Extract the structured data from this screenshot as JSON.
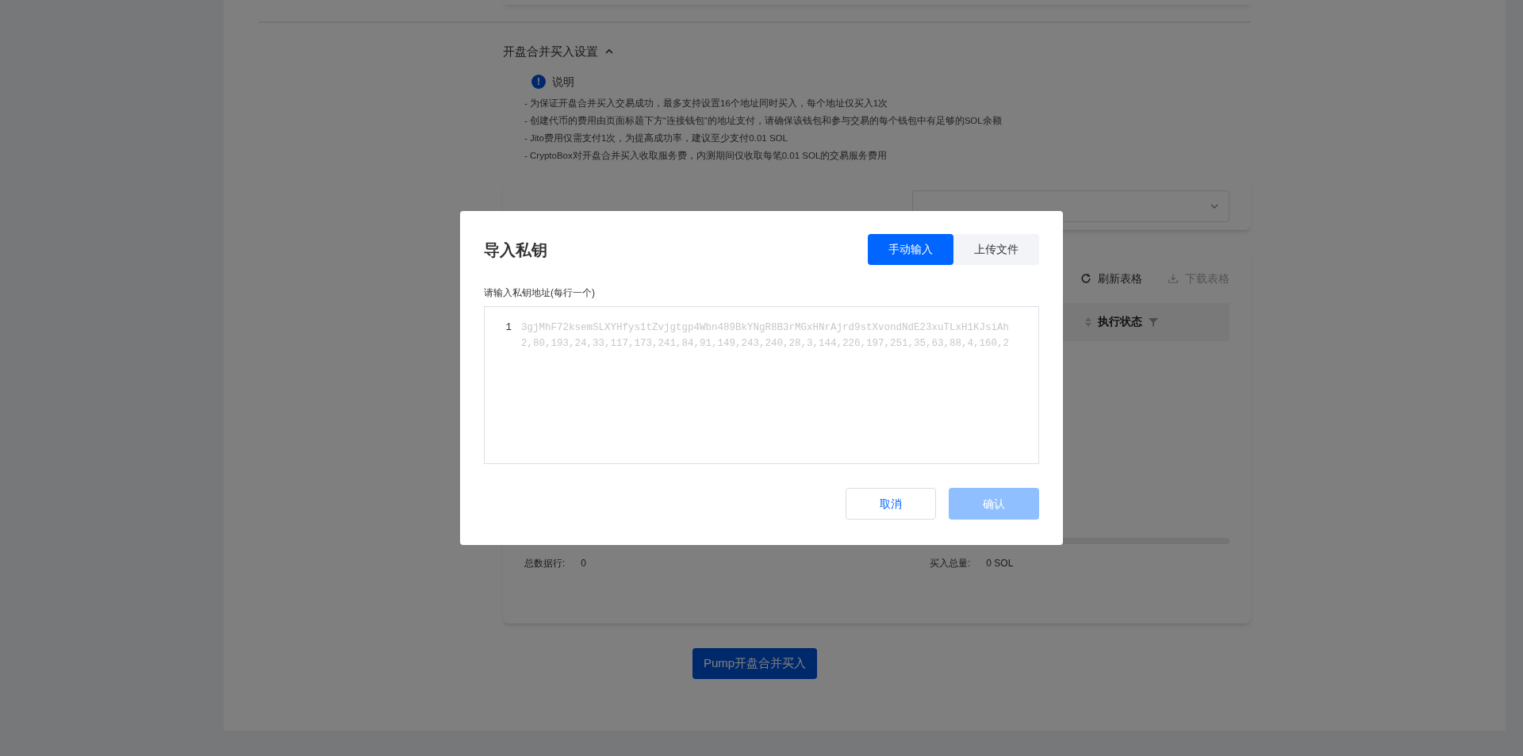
{
  "settings_section": {
    "title": "开盘合并买入设置",
    "expanded": true,
    "notice": {
      "icon": "!",
      "title": "说明",
      "lines": [
        "- 为保证开盘合并买入交易成功，最多支持设置16个地址同时买入，每个地址仅买入1次",
        "- 创建代币的费用由页面标题下方“连接钱包”的地址支付，请确保该钱包和参与交易的每个钱包中有足够的SOL余额",
        "- Jito费用仅需支付1次，为提高成功率，建议至少支付0.01 SOL",
        "- CryptoBox对开盘合并买入收取服务费，内测期间仅收取每笔0.01 SOL的交易服务费用"
      ]
    }
  },
  "table_toolbar": [
    {
      "kind": "refresh",
      "label": "刷新表格",
      "disabled": false
    },
    {
      "kind": "download",
      "label": "下载表格",
      "disabled": true
    }
  ],
  "table": {
    "columns": [
      {
        "label": "执行状态"
      }
    ]
  },
  "summary": [
    {
      "label": "总数据行:",
      "value": "0"
    },
    {
      "label": "买入总量:",
      "value": "0 SOL"
    }
  ],
  "submit_button": "Pump开盘合并买入",
  "dialog": {
    "title": "导入私钥",
    "tabs": [
      {
        "label": "手动输入",
        "selected": true
      },
      {
        "label": "上传文件",
        "selected": false
      }
    ],
    "field_label": "请输入私钥地址(每行一个)",
    "editor": {
      "line_number": "1",
      "placeholder": [
        "3gjMhF72ksemSLXYHfys1tZvjgtgp4Wbn489BkYNgR8B3rMGxHNrAjrd9stXvondNdE23xuTLxH1KJsiAh",
        "2,80,193,24,33,117,173,241,84,91,149,243,240,28,3,144,226,197,251,35,63,88,4,160,2"
      ]
    },
    "buttons": [
      {
        "kind": "cancel",
        "label": "取消",
        "disabled": false
      },
      {
        "kind": "confirm",
        "label": "确认",
        "disabled": true
      }
    ]
  }
}
